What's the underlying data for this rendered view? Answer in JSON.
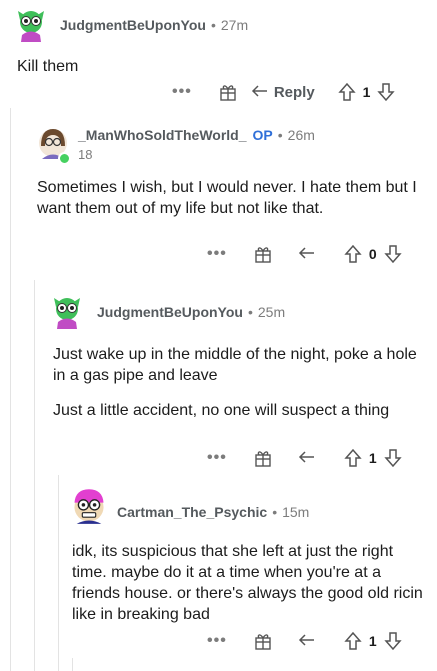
{
  "comments": [
    {
      "author": "JudgmentBeUponYou",
      "time": "27m",
      "paragraphs": [
        "Kill them"
      ],
      "reply_label": "Reply",
      "score": "1"
    },
    {
      "author": "_ManWhoSoldTheWorld_",
      "op_badge": "OP",
      "time": "26m",
      "flair": "18",
      "paragraphs": [
        "Sometimes I wish, but I would never. I hate them but I want them out of my life but not like that."
      ],
      "score": "0"
    },
    {
      "author": "JudgmentBeUponYou",
      "time": "25m",
      "paragraphs": [
        "Just wake up in the middle of the night, poke a hole in a gas pipe and leave",
        "Just a little accident, no one will suspect a thing"
      ],
      "score": "1"
    },
    {
      "author": "Cartman_The_Psychic",
      "time": "15m",
      "paragraphs": [
        "idk, its suspicious that she left at just the right time. maybe do it at a time when you're at a friends house. or there's always the good old ricin like in breaking bad"
      ],
      "score": "1"
    }
  ],
  "separator": "•",
  "more_label": "•••",
  "colors": {
    "op_blue": "#2f6fd8",
    "online_green": "#46d160",
    "meta_gray": "#7c7c7c"
  },
  "icons": [
    "more-icon",
    "award-gift-icon",
    "reply-arrow-icon",
    "upvote-arrow-icon",
    "downvote-arrow-icon"
  ]
}
